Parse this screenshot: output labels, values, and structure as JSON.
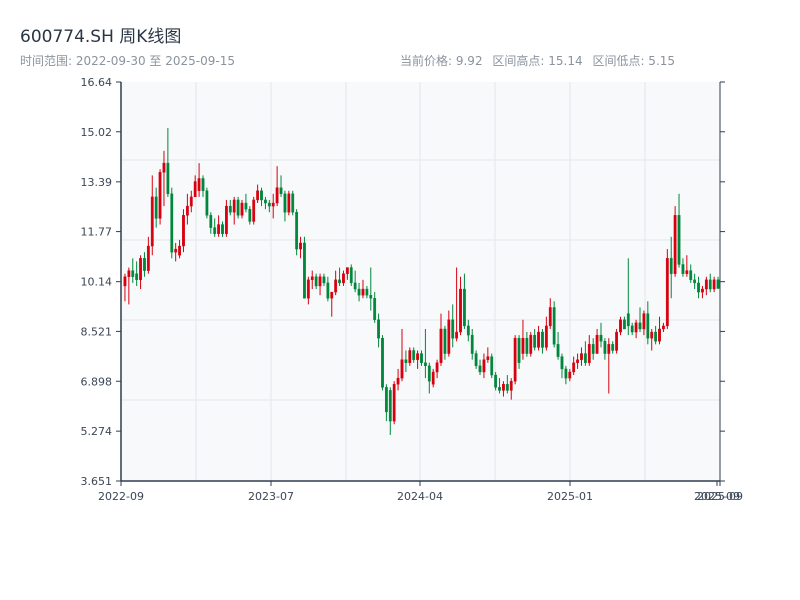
{
  "header": {
    "title": "600774.SH 周K线图",
    "range": "时间范围: 2022-09-30 至 2025-09-15",
    "current_price": "当前价格: 9.92",
    "range_high": "区间高点: 15.14",
    "range_low": "区间低点: 5.15"
  },
  "chart_data": {
    "type": "candlestick",
    "title": "600774.SH 周K线图",
    "ylim": [
      3.651,
      16.64
    ],
    "y_ticks": [
      "16.64",
      "15.02",
      "13.39",
      "11.77",
      "10.14",
      "8.521",
      "6.898",
      "5.274",
      "3.651"
    ],
    "x_ticks": [
      "2022-09",
      "2023-07",
      "2024-04",
      "2025-01",
      "2025-09"
    ],
    "grid": true,
    "colors": {
      "up": "#d7000f",
      "down": "#00873c",
      "background": "#f7f9fb"
    },
    "candles_ohlc": [
      [
        10.0,
        10.4,
        9.5,
        10.3
      ],
      [
        10.3,
        10.6,
        9.4,
        10.5
      ],
      [
        10.5,
        10.9,
        10.1,
        10.3
      ],
      [
        10.4,
        10.8,
        10.0,
        10.2
      ],
      [
        10.2,
        11.0,
        9.9,
        10.9
      ],
      [
        10.9,
        11.1,
        10.3,
        10.5
      ],
      [
        10.5,
        11.6,
        10.4,
        11.3
      ],
      [
        11.3,
        13.6,
        11.0,
        12.9
      ],
      [
        12.9,
        13.2,
        11.9,
        12.2
      ],
      [
        12.2,
        13.8,
        12.0,
        13.7
      ],
      [
        13.7,
        14.4,
        12.6,
        14.0
      ],
      [
        14.0,
        15.14,
        12.9,
        13.0
      ],
      [
        13.0,
        13.2,
        10.9,
        11.1
      ],
      [
        11.1,
        11.4,
        10.8,
        11.2
      ],
      [
        11.0,
        11.5,
        10.9,
        11.3
      ],
      [
        11.3,
        12.5,
        11.1,
        12.3
      ],
      [
        12.3,
        13.0,
        12.0,
        12.6
      ],
      [
        12.6,
        13.1,
        12.4,
        12.9
      ],
      [
        12.9,
        13.6,
        12.9,
        13.4
      ],
      [
        13.1,
        14.0,
        12.9,
        13.5
      ],
      [
        13.5,
        13.6,
        12.9,
        13.1
      ],
      [
        13.1,
        13.2,
        12.2,
        12.3
      ],
      [
        12.3,
        12.4,
        11.7,
        11.9
      ],
      [
        11.9,
        12.2,
        11.6,
        11.7
      ],
      [
        11.7,
        12.3,
        11.6,
        12.0
      ],
      [
        12.0,
        12.1,
        11.6,
        11.7
      ],
      [
        11.7,
        12.8,
        11.6,
        12.6
      ],
      [
        12.6,
        12.8,
        12.3,
        12.4
      ],
      [
        12.4,
        12.9,
        12.0,
        12.8
      ],
      [
        12.8,
        12.9,
        12.2,
        12.3
      ],
      [
        12.3,
        12.8,
        12.2,
        12.7
      ],
      [
        12.7,
        13.0,
        12.4,
        12.5
      ],
      [
        12.5,
        12.6,
        12.0,
        12.1
      ],
      [
        12.1,
        12.9,
        12.0,
        12.8
      ],
      [
        12.8,
        13.3,
        12.7,
        13.1
      ],
      [
        13.1,
        13.2,
        12.6,
        12.8
      ],
      [
        12.8,
        12.9,
        12.5,
        12.7
      ],
      [
        12.7,
        12.8,
        12.4,
        12.6
      ],
      [
        12.6,
        13.0,
        12.2,
        12.7
      ],
      [
        12.7,
        13.9,
        12.6,
        13.2
      ],
      [
        13.2,
        13.6,
        12.9,
        13.0
      ],
      [
        13.0,
        13.1,
        12.1,
        12.4
      ],
      [
        12.4,
        13.1,
        12.3,
        13.0
      ],
      [
        13.0,
        13.1,
        12.3,
        12.4
      ],
      [
        12.4,
        12.5,
        11.0,
        11.2
      ],
      [
        11.2,
        11.6,
        10.9,
        11.4
      ],
      [
        11.4,
        11.6,
        9.6,
        9.6
      ],
      [
        9.6,
        10.3,
        9.4,
        10.2
      ],
      [
        10.2,
        10.5,
        9.9,
        10.3
      ],
      [
        10.3,
        10.4,
        9.9,
        10.0
      ],
      [
        10.0,
        10.4,
        9.7,
        10.3
      ],
      [
        10.3,
        10.4,
        10.0,
        10.1
      ],
      [
        10.1,
        10.3,
        9.5,
        9.6
      ],
      [
        9.6,
        9.8,
        9.0,
        9.8
      ],
      [
        9.8,
        10.5,
        9.7,
        10.2
      ],
      [
        10.2,
        10.6,
        10.0,
        10.1
      ],
      [
        10.1,
        10.5,
        10.0,
        10.4
      ],
      [
        10.4,
        10.6,
        10.2,
        10.6
      ],
      [
        10.6,
        10.7,
        10.0,
        10.1
      ],
      [
        10.1,
        10.5,
        9.8,
        9.9
      ],
      [
        9.9,
        10.1,
        9.5,
        9.7
      ],
      [
        9.7,
        10.2,
        9.6,
        9.9
      ],
      [
        9.9,
        10.0,
        9.6,
        9.7
      ],
      [
        9.7,
        10.6,
        9.2,
        9.6
      ],
      [
        9.6,
        9.8,
        8.8,
        8.9
      ],
      [
        8.9,
        9.1,
        8.0,
        8.3
      ],
      [
        8.3,
        8.4,
        6.6,
        6.7
      ],
      [
        6.7,
        6.8,
        5.6,
        5.9
      ],
      [
        6.6,
        6.7,
        5.15,
        5.6
      ],
      [
        5.6,
        6.9,
        5.5,
        6.8
      ],
      [
        6.8,
        7.3,
        6.6,
        7.0
      ],
      [
        7.0,
        8.6,
        6.9,
        7.6
      ],
      [
        7.6,
        7.9,
        7.2,
        7.5
      ],
      [
        7.5,
        8.0,
        7.4,
        7.9
      ],
      [
        7.9,
        8.0,
        7.5,
        7.6
      ],
      [
        7.6,
        7.9,
        7.3,
        7.8
      ],
      [
        7.8,
        7.9,
        7.4,
        7.5
      ],
      [
        7.5,
        8.6,
        7.0,
        7.4
      ],
      [
        7.4,
        7.5,
        6.5,
        6.9
      ],
      [
        6.8,
        7.3,
        6.7,
        7.2
      ],
      [
        7.2,
        7.6,
        7.0,
        7.5
      ],
      [
        7.5,
        9.1,
        7.4,
        8.6
      ],
      [
        8.6,
        8.7,
        7.6,
        7.8
      ],
      [
        7.8,
        9.2,
        7.7,
        8.9
      ],
      [
        8.9,
        9.4,
        8.0,
        8.3
      ],
      [
        8.3,
        10.6,
        8.2,
        8.5
      ],
      [
        8.5,
        10.3,
        8.4,
        9.9
      ],
      [
        9.9,
        10.4,
        8.6,
        8.7
      ],
      [
        8.7,
        8.9,
        8.2,
        8.4
      ],
      [
        8.4,
        8.6,
        7.6,
        7.8
      ],
      [
        7.8,
        7.9,
        7.3,
        7.4
      ],
      [
        7.4,
        7.6,
        7.1,
        7.2
      ],
      [
        7.2,
        7.8,
        7.0,
        7.6
      ],
      [
        7.6,
        8.0,
        7.5,
        7.7
      ],
      [
        7.7,
        7.8,
        7.0,
        7.1
      ],
      [
        7.1,
        7.2,
        6.6,
        6.7
      ],
      [
        6.7,
        7.0,
        6.5,
        6.6
      ],
      [
        6.6,
        6.9,
        6.4,
        6.8
      ],
      [
        6.8,
        7.1,
        6.5,
        6.6
      ],
      [
        6.6,
        7.0,
        6.3,
        6.9
      ],
      [
        6.9,
        8.4,
        6.8,
        8.3
      ],
      [
        8.3,
        8.4,
        7.3,
        7.5
      ],
      [
        7.8,
        8.9,
        7.6,
        8.3
      ],
      [
        8.3,
        8.5,
        7.7,
        7.8
      ],
      [
        7.8,
        8.5,
        7.7,
        8.4
      ],
      [
        8.4,
        8.6,
        7.9,
        8.0
      ],
      [
        8.0,
        8.7,
        7.9,
        8.5
      ],
      [
        8.5,
        8.6,
        7.8,
        8.0
      ],
      [
        8.0,
        9.0,
        7.9,
        8.7
      ],
      [
        8.7,
        9.6,
        8.6,
        9.3
      ],
      [
        9.3,
        9.5,
        8.0,
        8.1
      ],
      [
        8.1,
        8.5,
        7.6,
        7.7
      ],
      [
        7.7,
        7.8,
        7.0,
        7.3
      ],
      [
        7.3,
        7.4,
        6.8,
        7.0
      ],
      [
        7.0,
        7.3,
        6.9,
        7.2
      ],
      [
        7.2,
        7.7,
        7.1,
        7.5
      ],
      [
        7.5,
        7.8,
        7.3,
        7.6
      ],
      [
        7.6,
        8.0,
        7.4,
        7.8
      ],
      [
        7.8,
        8.2,
        7.4,
        7.5
      ],
      [
        7.5,
        8.4,
        7.4,
        8.1
      ],
      [
        8.1,
        8.3,
        7.6,
        7.8
      ],
      [
        7.8,
        8.6,
        7.8,
        8.4
      ],
      [
        8.4,
        8.8,
        8.0,
        8.2
      ],
      [
        8.2,
        8.3,
        7.6,
        7.8
      ],
      [
        7.8,
        8.3,
        6.5,
        8.1
      ],
      [
        8.1,
        8.2,
        7.8,
        7.9
      ],
      [
        7.9,
        8.6,
        7.8,
        8.5
      ],
      [
        8.5,
        9.0,
        8.4,
        8.9
      ],
      [
        8.9,
        9.0,
        8.6,
        8.6
      ],
      [
        9.1,
        10.9,
        8.4,
        8.7
      ],
      [
        8.7,
        8.8,
        8.4,
        8.5
      ],
      [
        8.5,
        8.9,
        8.3,
        8.8
      ],
      [
        8.8,
        9.3,
        8.5,
        8.6
      ],
      [
        8.6,
        9.2,
        8.4,
        9.1
      ],
      [
        9.1,
        9.5,
        8.1,
        8.3
      ],
      [
        8.3,
        8.6,
        7.9,
        8.5
      ],
      [
        8.5,
        8.7,
        8.1,
        8.2
      ],
      [
        8.2,
        9.0,
        8.1,
        8.6
      ],
      [
        8.6,
        8.8,
        8.5,
        8.7
      ],
      [
        8.7,
        11.2,
        8.6,
        10.9
      ],
      [
        10.9,
        11.6,
        9.6,
        10.4
      ],
      [
        10.4,
        12.6,
        10.3,
        12.3
      ],
      [
        12.3,
        13.0,
        10.6,
        10.7
      ],
      [
        10.7,
        10.9,
        10.3,
        10.4
      ],
      [
        10.4,
        11.0,
        10.3,
        10.5
      ],
      [
        10.5,
        10.7,
        10.1,
        10.2
      ],
      [
        10.2,
        10.4,
        9.9,
        10.1
      ],
      [
        10.1,
        10.3,
        9.6,
        9.8
      ],
      [
        9.8,
        10.0,
        9.6,
        9.9
      ],
      [
        9.9,
        10.3,
        9.7,
        10.2
      ],
      [
        10.2,
        10.4,
        9.8,
        9.9
      ],
      [
        9.9,
        10.3,
        9.8,
        10.2
      ],
      [
        10.2,
        10.3,
        9.9,
        9.92
      ]
    ]
  }
}
